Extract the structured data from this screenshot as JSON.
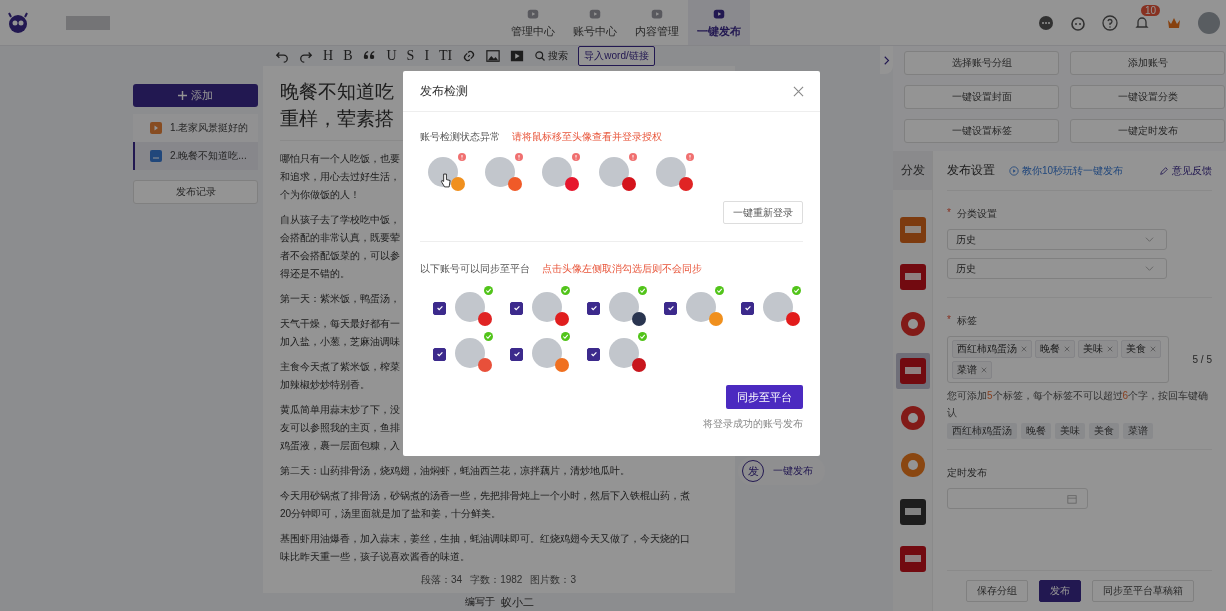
{
  "nav": {
    "tabs": [
      {
        "label": "管理中心",
        "selected": false
      },
      {
        "label": "账号中心",
        "selected": false
      },
      {
        "label": "内容管理",
        "selected": false
      },
      {
        "label": "一键发布",
        "selected": true
      }
    ],
    "notification_count": "10"
  },
  "sidebar": {
    "add_button": "添加",
    "items": [
      {
        "label": "1.老家风景挺好的",
        "kind": "video",
        "selected": false
      },
      {
        "label": "2.晚餐不知道吃...",
        "kind": "article",
        "selected": true
      }
    ],
    "history_button": "发布记录"
  },
  "toolbar": {
    "items": [
      {
        "kind": "undo"
      },
      {
        "kind": "redo"
      },
      {
        "kind": "letter",
        "label": "H"
      },
      {
        "kind": "letter",
        "label": "B"
      },
      {
        "kind": "quote"
      },
      {
        "kind": "letter",
        "label": "U"
      },
      {
        "kind": "letter",
        "label": "S"
      },
      {
        "kind": "letter",
        "label": "I"
      },
      {
        "kind": "letter",
        "label": "TI"
      },
      {
        "kind": "link"
      },
      {
        "kind": "image"
      },
      {
        "kind": "video"
      },
      {
        "kind": "search",
        "label": "搜索"
      },
      {
        "kind": "import",
        "label": "导入word/链接"
      }
    ]
  },
  "editor": {
    "title_lines": [
      "晚餐不知道吃",
      "重样，荤素搭"
    ],
    "paragraphs": [
      {
        "lines": [
          "哪怕只有一个人吃饭，也要",
          "和追求，用心去过好生活，",
          "个为你做饭的人！"
        ]
      },
      {
        "lines": [
          "自从孩子去了学校吃中饭，",
          "会搭配的非常认真，既要荤",
          "者不会搭配饭菜的，可以参",
          "得还是不错的。"
        ]
      },
      {
        "lines": [
          "第一天：紫米饭，鸭蛋汤，"
        ]
      },
      {
        "lines": [
          "天气干燥，每天最好都有一",
          "加入盐，小葱，芝麻油调味"
        ]
      },
      {
        "lines": [
          "主食今天煮了紫米饭，榨菜",
          "加辣椒炒炒特别香。"
        ]
      },
      {
        "lines": [
          "黄瓜简单用蒜末炒了下，没",
          "友可以参照我的主页，鱼排",
          "鸡蛋液，裹一层面包糠，入"
        ]
      },
      {
        "lines": [
          "第二天：山药排骨汤，烧鸡翅，油焖虾，蚝油西兰花，凉拌藕片，清炒地瓜叶。"
        ]
      },
      {
        "lines": [
          "今天用砂锅煮了排骨汤，砂锅煮的汤香一些，先把排骨炖上一个小时，然后下入铁棍山药，煮",
          "20分钟即可，汤里面就是加了盐和姜，十分鲜美。"
        ]
      },
      {
        "lines": [
          "基围虾用油爆香，加入蒜末，姜丝，生抽，蚝油调味即可。红烧鸡翅今天又做了，今天烧的口",
          "味比昨天重一些，孩子说喜欢酱香的味道。"
        ]
      }
    ],
    "stats": [
      "段落：34",
      "字数：1982",
      "图片数：3"
    ],
    "author_label": "编写于",
    "author": "蚁小二"
  },
  "float_button": {
    "icon_text": "发",
    "label": "一键发布"
  },
  "right_panel": {
    "actions": [
      "选择账号分组",
      "添加账号",
      "一键设置封面",
      "一键设置分类",
      "一键设置标签",
      "一键定时发布"
    ],
    "side_tab": "分发",
    "header": "发布设置",
    "tutorial_link": "教你10秒玩转一键发布",
    "feedback_link": "意见反馈",
    "platforms": [
      {
        "kind": "orange-block",
        "selected": false
      },
      {
        "kind": "red-block",
        "selected": false
      },
      {
        "kind": "red-round",
        "selected": false
      },
      {
        "kind": "red-block",
        "selected": true
      },
      {
        "kind": "red-round",
        "selected": false
      },
      {
        "kind": "orange-round",
        "selected": false
      },
      {
        "kind": "dark-block",
        "selected": false
      },
      {
        "kind": "red-block",
        "selected": false
      }
    ],
    "category": {
      "label": "分类设置",
      "required_mark": "*",
      "selects": [
        "历史",
        "历史"
      ]
    },
    "tags": {
      "label": "标签",
      "required_mark": "*",
      "values": [
        "西红柿鸡蛋汤",
        "晚餐",
        "美味",
        "美食",
        "菜谱"
      ],
      "count": "5 / 5",
      "hint": "您可添加**5**个标签，每个标签不可以超过**6**个字，按回车键确认",
      "suggestions": [
        "西红柿鸡蛋汤",
        "晚餐",
        "美味",
        "美食",
        "菜谱"
      ]
    },
    "schedule": {
      "label": "定时发布"
    },
    "buttons": [
      {
        "label": "保存分组",
        "kind": "default"
      },
      {
        "label": "发布",
        "kind": "primary"
      },
      {
        "label": "同步至平台草稿箱",
        "kind": "default"
      }
    ]
  },
  "dialog": {
    "title": "发布检测",
    "error_section": {
      "label": "账号检测状态异常",
      "hint": "请将鼠标移至头像查看并登录授权",
      "accounts": [
        {
          "color": "#f0901e"
        },
        {
          "color": "#f05a28"
        },
        {
          "color": "#e6162d"
        },
        {
          "color": "#d4141c"
        },
        {
          "color": "#e02424"
        }
      ],
      "relogin_button": "一键重新登录"
    },
    "sync_section": {
      "label": "以下账号可以同步至平台",
      "hint": "点击头像左侧取消勾选后则不会同步",
      "accounts": [
        {
          "checked": true,
          "color": "#e02424"
        },
        {
          "checked": true,
          "color": "#e01e1e"
        },
        {
          "checked": true,
          "color": "#2a3550"
        },
        {
          "checked": true,
          "color": "#f0901e"
        },
        {
          "checked": true,
          "color": "#e21c1c"
        },
        {
          "checked": true,
          "color": "#e8503a"
        },
        {
          "checked": true,
          "color": "#f07020"
        },
        {
          "checked": true,
          "color": "#c8161d"
        }
      ],
      "sync_button": "同步至平台",
      "note": "将登录成功的账号发布"
    }
  }
}
